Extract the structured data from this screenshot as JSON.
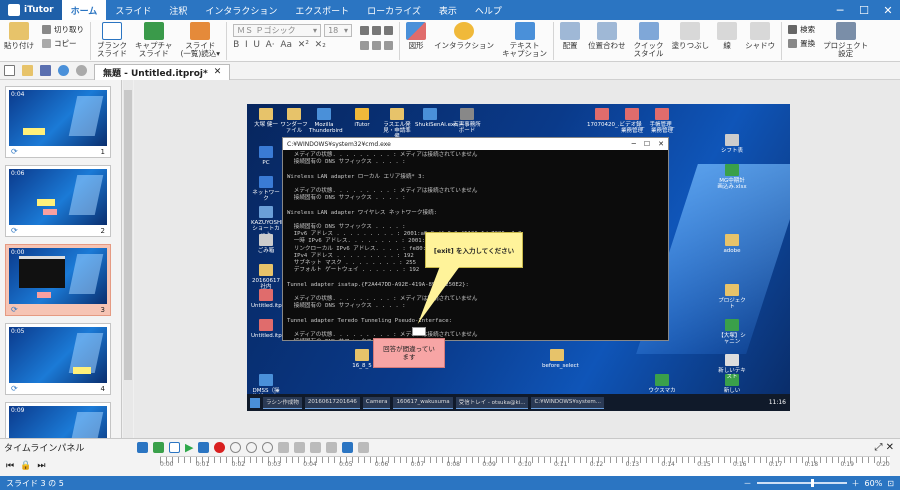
{
  "app": {
    "name": "iTutor"
  },
  "tabs": [
    "ホーム",
    "スライド",
    "注釈",
    "インタラクション",
    "エクスポート",
    "ローカライズ",
    "表示",
    "ヘルプ"
  ],
  "active_tab": "ホーム",
  "ribbon": {
    "paste": "貼り付け",
    "cut": "切り取り",
    "copy": "コピー",
    "blank_slide": "ブランク\nスライド",
    "capture_slide": "キャプチャ\nスライド",
    "slide_import": "スライド\n(一覧)読込▾",
    "font_name": "ＭＳ Ｐゴシック",
    "font_size": "18",
    "format_row": "B  I  U  A·  Aa  ✕²  ✕₂",
    "shape": "図形",
    "interaction": "インタラクション",
    "text_caption": "テキスト\nキャプション",
    "arrange": "配置",
    "position": "位置合わせ",
    "quick_style": "クイック\nスタイル",
    "fill": "塗りつぶし",
    "line": "線",
    "shadow": "シャドウ",
    "find": "検索",
    "replace": "置換",
    "project_settings": "プロジェクト\n設定"
  },
  "document_tab": {
    "title": "無題 - Untitled.itproj*"
  },
  "slides": [
    {
      "num": "1",
      "time": "0:04"
    },
    {
      "num": "2",
      "time": "0:06"
    },
    {
      "num": "3",
      "time": "0:00"
    },
    {
      "num": "4",
      "time": "0:05"
    },
    {
      "num": "5",
      "time": "0:09"
    }
  ],
  "selected_slide": "3",
  "slide": {
    "cmd_title": "C:¥WINDOWS¥system32¥cmd.exe",
    "cmd_lines": [
      "  メディアの状態. . . . . . . . . : メディアは接続されていません",
      "  接続固有の DNS サフィックス . . . . :",
      "",
      "Wireless LAN adapter ローカル エリア接続* 3:",
      "",
      "  メディアの状態. . . . . . . . . : メディアは接続されていません",
      "  接続固有の DNS サフィックス . . . . :",
      "",
      "Wireless LAN adapter ワイヤレス ネットワーク接続:",
      "",
      "  接続固有の DNS サフィックス . . . . :",
      "  IPv6 アドレス . . . . . . . . . : 2001:a0a8:dfe0:0:f5126a1d:7086:a1e8",
      "  一時 IPv6 アドレス. . . . . . . . : 2001:a0a8:dfe0:0:a3b:8a51:9e69",
      "  リンクローカル IPv6 アドレス. . . . : fe80::f5126a1d:7086:a1e8%3",
      "  IPv4 アドレス . . . . . . . . . : 192",
      "  サブネット マスク . . . . . . . . : 255",
      "  デフォルト ゲートウェイ . . . . . . : 192",
      "",
      "Tunnel adapter isatap.{F2A447DD-A92E-419A-8958-250E2}:",
      "",
      "  メディアの状態. . . . . . . . . : メディアは接続されていません",
      "  接続固有の DNS サフィックス . . . . :",
      "",
      "Tunnel adapter Teredo Tunneling Pseudo-Interface:",
      "",
      "  メディアの状態. . . . . . . . . : メディアは接続されていません",
      "  接続固有の DNS サフィックス . . . . :",
      "",
      "C:¥Users¥otsuka>"
    ],
    "callout_yellow": "[exit] を入力してください",
    "callout_pink": "回答が間違ってい\nます",
    "desktop_icons": [
      "大塚 健一",
      "PC",
      "ネットワーク",
      "KAZUYOSHI-ショートカット",
      "ごみ箱",
      "20160617社内",
      "Untitled.itproj",
      "Untitled.itproj",
      "DMSS（操作ゲー…）申込書.doc",
      "新しいMicrosoft…xlsx",
      "ワンダーファイル",
      "Mozilla Thunderbird",
      "iTutor",
      "ラスエル発見・申請準備",
      "ShukiSenAi.exe",
      "石黒事務所ボード",
      "17070420_…",
      "ビデオ録_業務管理",
      "手帳管理_業務管理",
      "シフト表",
      "MG中期計画込み.xlsx",
      "adobe",
      "プロジェクト",
      "【大塚】シャニン",
      "ウクスマカロフ.xlsx",
      "新しいテキスト",
      "before_select",
      "16_8_5"
    ],
    "taskbar_items": [
      "ラシン作成物",
      "20160617201646",
      "Camera",
      "160617_wakusuma",
      "受信トレイ - otsuka@ki...",
      "C:¥WINDOWS¥system..."
    ],
    "taskbar_time": "11:16"
  },
  "timeline": {
    "label": "タイムラインパネル",
    "marks": [
      "0:00",
      "0:01",
      "0:02",
      "0:03",
      "0:04",
      "0:05",
      "0:06",
      "0:07",
      "0:08",
      "0:09",
      "0:10",
      "0:11",
      "0:12",
      "0:13",
      "0:14",
      "0:15",
      "0:16",
      "0:17",
      "0:18",
      "0:19",
      "0:20"
    ]
  },
  "status": {
    "text": "スライド 3 の 5",
    "zoom": "60%"
  }
}
